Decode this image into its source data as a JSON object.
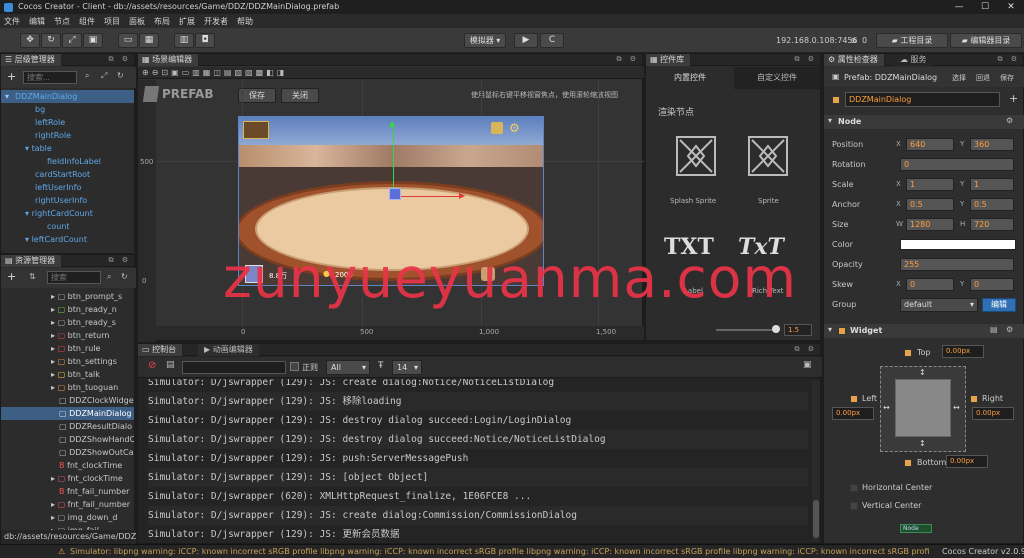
{
  "window": {
    "title": "Cocos Creator - Client - db://assets/resources/Game/DDZ/DDZMainDialog.prefab"
  },
  "menu": [
    "文件",
    "编辑",
    "节点",
    "组件",
    "项目",
    "面板",
    "布局",
    "扩展",
    "开发者",
    "帮助"
  ],
  "toolbar": {
    "simulator": "模拟器 ▾",
    "play": "▶",
    "refresh": "C",
    "ip": "192.168.0.108:7456",
    "wifi_count": "0",
    "project_dir": "工程目录",
    "editor_dir": "编辑器目录"
  },
  "hierarchy": {
    "tab": "层级管理器",
    "search_placeholder": "搜索...",
    "items": [
      {
        "label": "DDZMainDialog",
        "level": 0
      },
      {
        "label": "bg",
        "level": 1
      },
      {
        "label": "leftRole",
        "level": 1
      },
      {
        "label": "rightRole",
        "level": 1
      },
      {
        "label": "table",
        "level": 1
      },
      {
        "label": "fieldInfoLabel",
        "level": 2
      },
      {
        "label": "cardStartRoot",
        "level": 1
      },
      {
        "label": "leftUserInfo",
        "level": 1
      },
      {
        "label": "rightUserInfo",
        "level": 1
      },
      {
        "label": "rightCardCount",
        "level": 1
      },
      {
        "label": "count",
        "level": 2
      },
      {
        "label": "leftCardCount",
        "level": 1
      }
    ]
  },
  "assets": {
    "tab": "资源管理器",
    "search_placeholder": "搜索",
    "items": [
      "btn_prompt_s",
      "btn_ready_n",
      "btn_ready_s",
      "btn_return",
      "btn_rule",
      "btn_settings",
      "btn_talk",
      "btn_tuoguan",
      "DDZClockWidge",
      "DDZMainDialog",
      "DDZResultDialo",
      "DDZShowHandC",
      "DDZShowOutCa",
      "fnt_clockTime",
      "fnt_clockTime",
      "fnt_fail_number",
      "fnt_fail_number",
      "img_down_d",
      "img_fail"
    ],
    "path": "db://assets/resources/Game/DDZ..."
  },
  "scene": {
    "tab": "场景编辑器",
    "prefab_label": "PREFAB",
    "save": "保存",
    "close": "关闭",
    "hint": "使用鼠标右键平移视窗焦点，使用滚轮缩放视图",
    "ruler_y": "500",
    "ruler_x": [
      "0",
      "500",
      "1,000",
      "1,500"
    ],
    "ruler_y0": "0",
    "hud_score": "8.8万",
    "hud_gold": "2000"
  },
  "controls": {
    "tab": "控件库",
    "tab_builtin": "内置控件",
    "tab_custom": "自定义控件",
    "section": "渲染节点",
    "widgets": [
      "Splash Sprite",
      "Sprite"
    ],
    "txt1": "TXT",
    "txt2": "TxT",
    "label": "Label",
    "richtext": "Rich Text",
    "zoom": "1.5"
  },
  "console": {
    "tab_console": "控制台",
    "tab_anim": "动画编辑器",
    "regex": "正则",
    "level": "All",
    "fontsize": "14",
    "lines": [
      "Simulator: D/jswrapper (129): JS: create dialog:Notice/NoticeListDialog",
      "Simulator: D/jswrapper (129): JS: 移除loading",
      "Simulator: D/jswrapper (129): JS: destroy dialog succeed:Login/LoginDialog",
      "Simulator: D/jswrapper (129): JS: destroy dialog succeed:Notice/NoticeListDialog",
      "Simulator: D/jswrapper (129): JS: push:ServerMessagePush",
      "Simulator: D/jswrapper (129): JS: [object Object]",
      "Simulator: D/jswrapper (620): XMLHttpRequest_finalize, 1E06FCE8 ...",
      "Simulator: D/jswrapper (129): JS: create dialog:Commission/CommissionDialog",
      "Simulator: D/jswrapper (129): JS: 更新会员数据"
    ]
  },
  "inspector": {
    "tab": "属性检查器",
    "tab2": "服务",
    "prefab_name": "Prefab: DDZMainDialog",
    "select": "选择",
    "revert": "回退",
    "save": "保存",
    "node_name": "DDZMainDialog",
    "node_section": "Node",
    "position": {
      "label": "Position",
      "x": "640",
      "y": "360"
    },
    "rotation": {
      "label": "Rotation",
      "v": "0"
    },
    "scale": {
      "label": "Scale",
      "x": "1",
      "y": "1"
    },
    "anchor": {
      "label": "Anchor",
      "x": "0.5",
      "y": "0.5"
    },
    "size": {
      "label": "Size",
      "w": "1280",
      "h": "720"
    },
    "color_label": "Color",
    "opacity": {
      "label": "Opacity",
      "v": "255"
    },
    "skew": {
      "label": "Skew",
      "x": "0",
      "y": "0"
    },
    "group": {
      "label": "Group",
      "v": "default",
      "edit": "编辑"
    },
    "widget_section": "Widget",
    "top": {
      "label": "Top",
      "v": "0.00px"
    },
    "left": {
      "label": "Left",
      "v": "0.00px"
    },
    "right": {
      "label": "Right",
      "v": "0.00px"
    },
    "bottom": {
      "label": "Bottom",
      "v": "0.00px"
    },
    "hcenter": "Horizontal Center",
    "vcenter": "Vertical Center",
    "badge": "Node"
  },
  "status": {
    "warning": "Simulator: libpng warning: iCCP: known incorrect sRGB profile libpng warning: iCCP: known incorrect sRGB profile libpng warning: iCCP: known incorrect sRGB profile libpng warning: iCCP: known incorrect sRGB profile libpng warning: iCCP: known",
    "version": "Cocos Creator v2.0.9"
  },
  "watermark": "zunyueyuanma.com",
  "colors": {
    "accent": "#3b8bd9",
    "field_text": "#ff9e3d",
    "tree_blue": "#5fa8e8",
    "watermark": "#e83448"
  }
}
